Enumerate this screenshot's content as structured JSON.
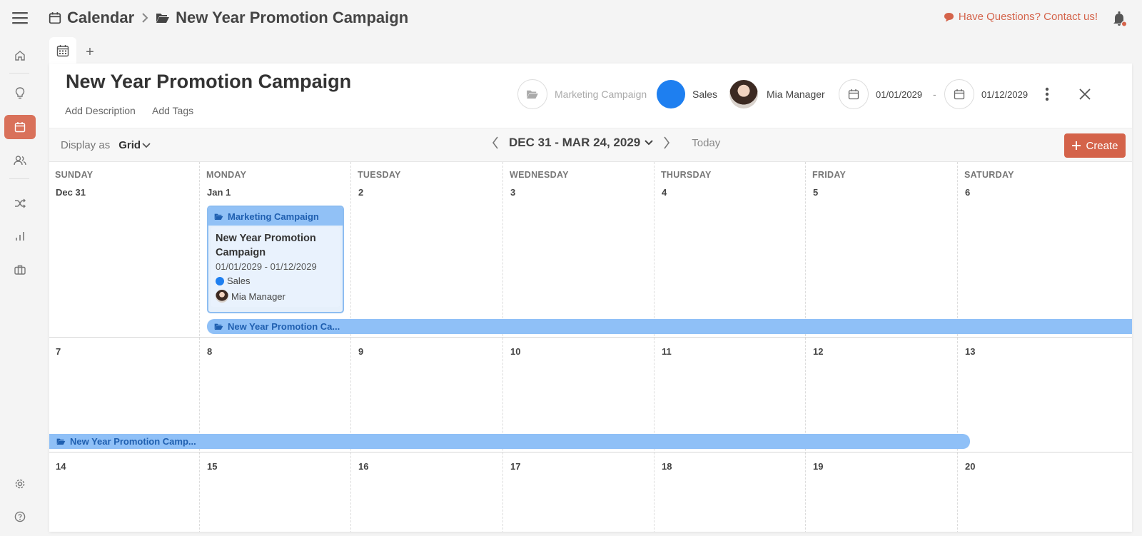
{
  "breadcrumb": {
    "root": "Calendar",
    "current": "New Year Promotion Campaign"
  },
  "contact_label": "Have Questions? Contact us!",
  "tab_add_label": "+",
  "panel": {
    "title": "New Year Promotion Campaign",
    "add_description": "Add Description",
    "add_tags": "Add Tags",
    "folder": "Marketing Campaign",
    "team": "Sales",
    "team_color": "#1e7ff0",
    "owner": "Mia Manager",
    "start_date": "01/01/2029",
    "date_sep": "-",
    "end_date": "01/12/2029"
  },
  "toolbar": {
    "display_as": "Display as",
    "view": "Grid",
    "range": "DEC 31 - MAR 24, 2029",
    "today": "Today",
    "create": "Create"
  },
  "calendar": {
    "day_names": [
      "SUNDAY",
      "MONDAY",
      "TUESDAY",
      "WEDNESDAY",
      "THURSDAY",
      "FRIDAY",
      "SATURDAY"
    ],
    "weeks": [
      [
        "Dec 31",
        "Jan 1",
        "2",
        "3",
        "4",
        "5",
        "6"
      ],
      [
        "7",
        "8",
        "9",
        "10",
        "11",
        "12",
        "13"
      ],
      [
        "14",
        "15",
        "16",
        "17",
        "18",
        "19",
        "20"
      ]
    ],
    "event_card": {
      "folder": "Marketing Campaign",
      "title": "New Year Promotion Campaign",
      "dates": "01/01/2029 - 01/12/2029",
      "team": "Sales",
      "owner": "Mia Manager"
    },
    "bar_week1": "New Year Promotion Ca...",
    "bar_week2": "New Year Promotion Camp..."
  },
  "colors": {
    "accent": "#d4634a",
    "event_bar": "#8fc0f7",
    "team_dot": "#1e7ff0"
  }
}
